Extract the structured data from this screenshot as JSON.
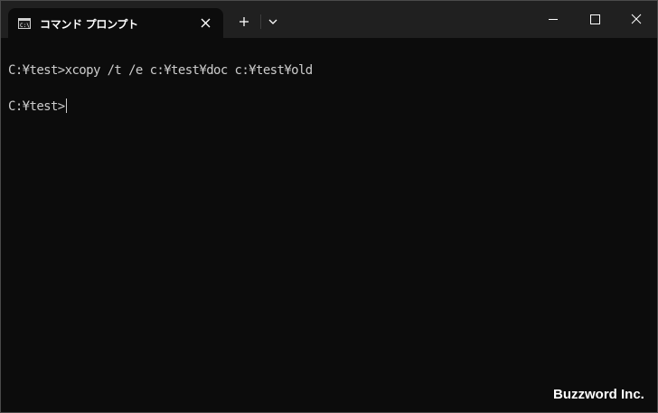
{
  "tab": {
    "title": "コマンド プロンプト",
    "icon": "cmd-icon"
  },
  "titlebar": {
    "new_tab_icon": "plus-icon",
    "dropdown_icon": "chevron-down-icon",
    "minimize_icon": "minimize-icon",
    "maximize_icon": "maximize-icon",
    "close_icon": "close-icon"
  },
  "terminal": {
    "lines": [
      "C:¥test>xcopy /t /e c:¥test¥doc c:¥test¥old",
      "C:¥test>"
    ]
  },
  "watermark": "Buzzword Inc.",
  "colors": {
    "titlebar_bg": "#202020",
    "terminal_bg": "#0c0c0c",
    "terminal_text": "#cccccc"
  }
}
